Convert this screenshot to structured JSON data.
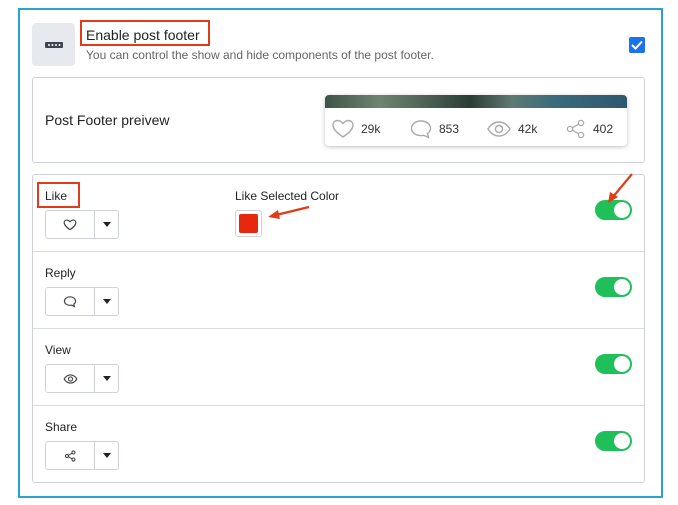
{
  "setting": {
    "title": "Enable post footer",
    "description": "You can control the show and hide components of the post footer.",
    "icon": "dots-icon",
    "enabled": true
  },
  "preview": {
    "label": "Post Footer preivew",
    "stats": [
      {
        "icon": "heart-icon",
        "value": "29k"
      },
      {
        "icon": "comment-icon",
        "value": "853"
      },
      {
        "icon": "eye-icon",
        "value": "42k"
      },
      {
        "icon": "share-icon",
        "value": "402"
      }
    ]
  },
  "components": [
    {
      "label": "Like",
      "icon": "heart-icon",
      "enabled": true,
      "color_label": "Like Selected Color",
      "selected_color": "#e8270f"
    },
    {
      "label": "Reply",
      "icon": "comment-icon",
      "enabled": true
    },
    {
      "label": "View",
      "icon": "eye-icon",
      "enabled": true
    },
    {
      "label": "Share",
      "icon": "share-icon",
      "enabled": true
    }
  ],
  "colors": {
    "accent": "#2aa3cf",
    "toggle_on": "#1fbf5a",
    "checkbox": "#1a73e8",
    "highlight": "#e23b17"
  }
}
